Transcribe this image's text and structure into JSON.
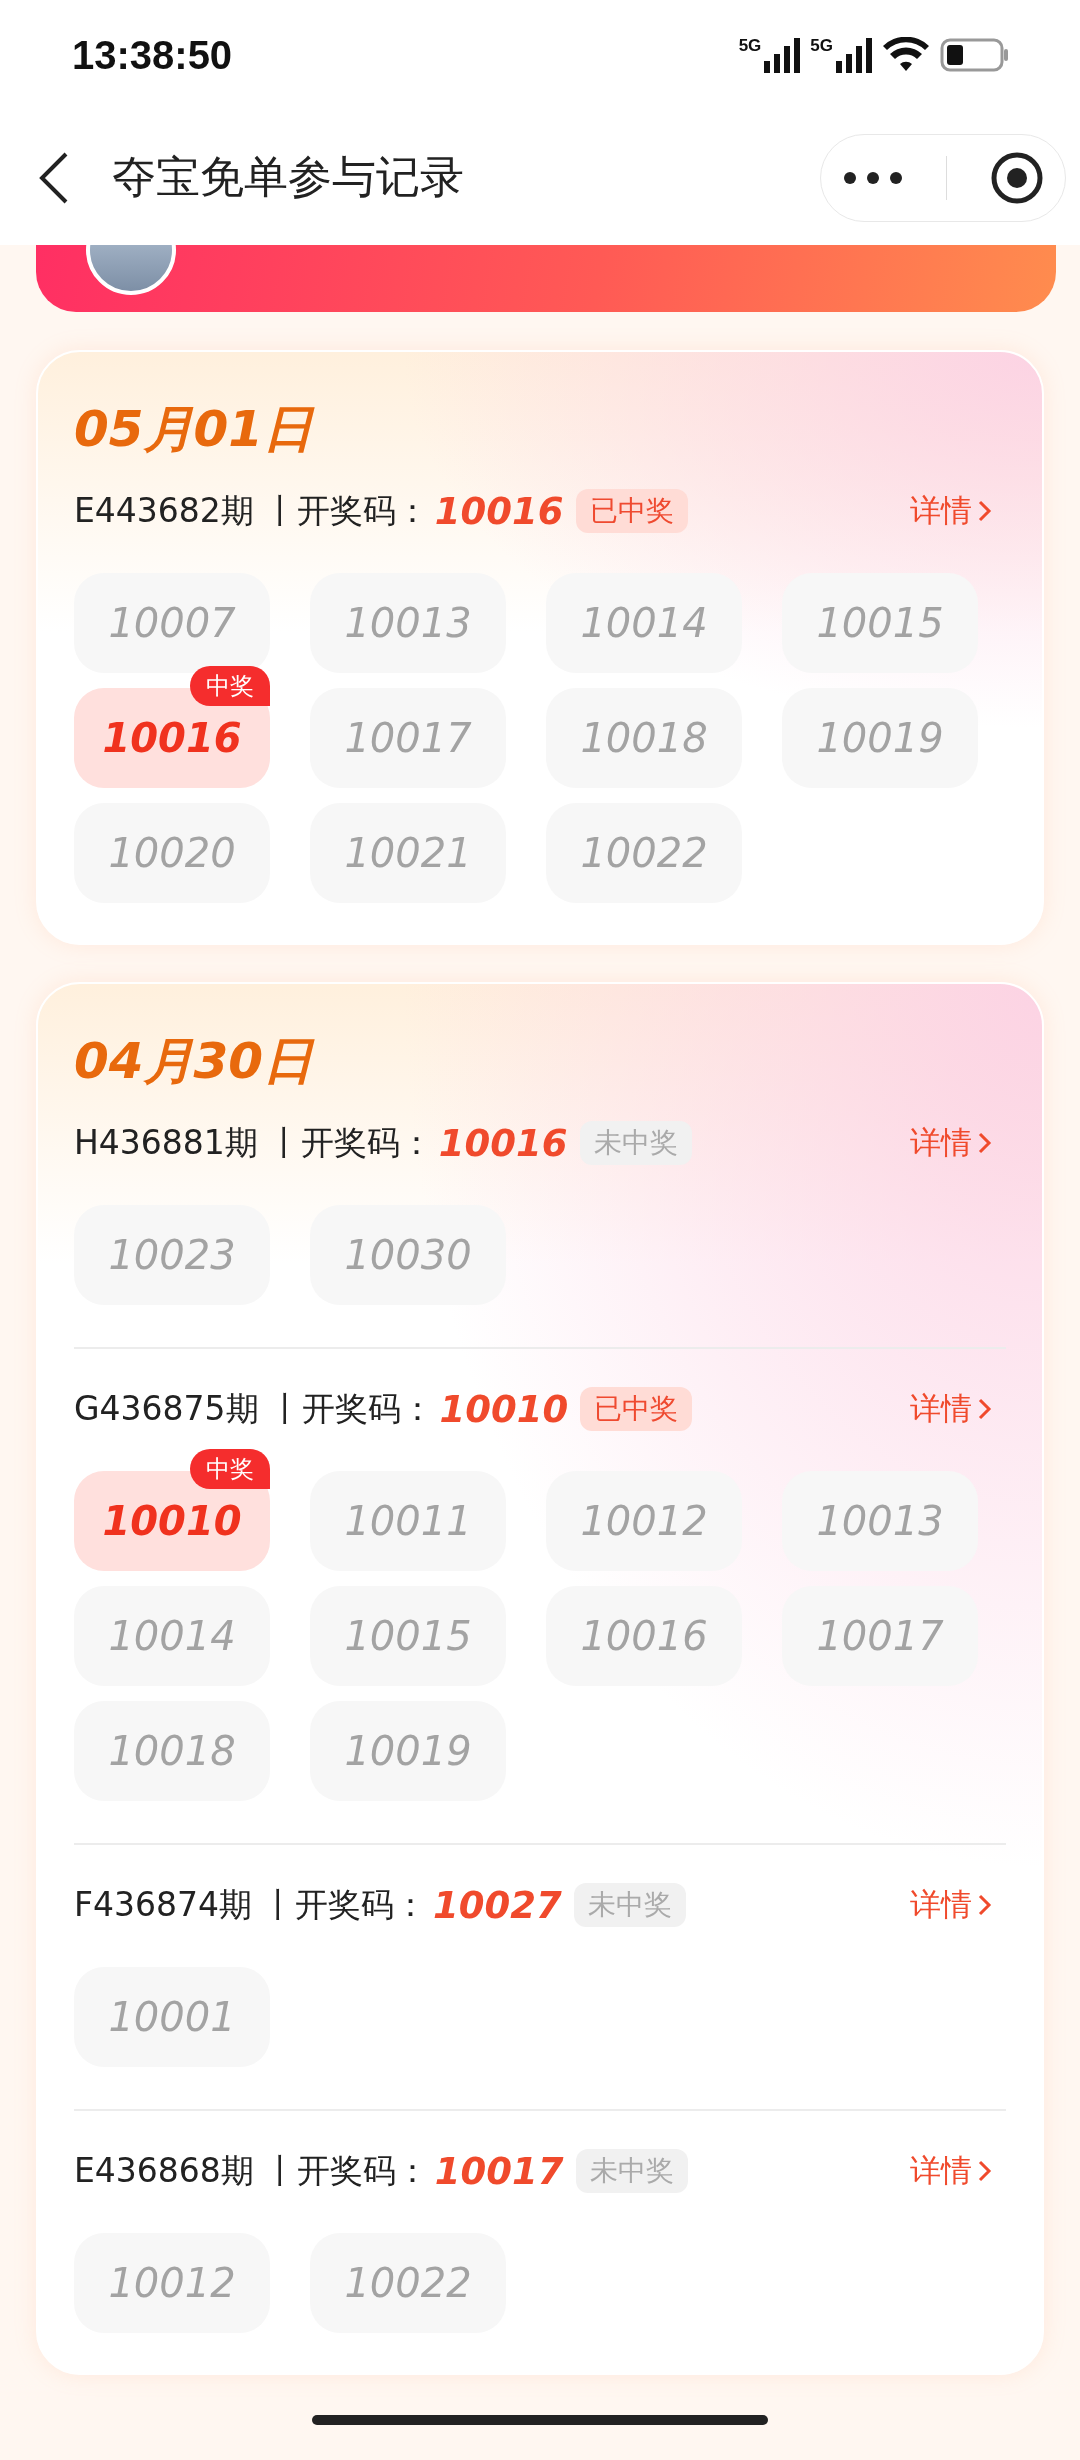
{
  "status_bar": {
    "time": "13:38:50",
    "networks": [
      "5G",
      "5G"
    ]
  },
  "nav": {
    "title": "夺宝免单参与记录"
  },
  "days": [
    {
      "date": "05月01日",
      "periods": [
        {
          "period": "E443682期",
          "code_label": "丨开奖码：",
          "code": "10016",
          "status": "已中奖",
          "won": true,
          "detail": "详情",
          "tickets": [
            {
              "number": "10007",
              "won": false
            },
            {
              "number": "10013",
              "won": false
            },
            {
              "number": "10014",
              "won": false
            },
            {
              "number": "10015",
              "won": false
            },
            {
              "number": "10016",
              "won": true,
              "badge": "中奖"
            },
            {
              "number": "10017",
              "won": false
            },
            {
              "number": "10018",
              "won": false
            },
            {
              "number": "10019",
              "won": false
            },
            {
              "number": "10020",
              "won": false
            },
            {
              "number": "10021",
              "won": false
            },
            {
              "number": "10022",
              "won": false
            }
          ]
        }
      ]
    },
    {
      "date": "04月30日",
      "periods": [
        {
          "period": "H436881期",
          "code_label": "丨开奖码：",
          "code": "10016",
          "status": "未中奖",
          "won": false,
          "detail": "详情",
          "tickets": [
            {
              "number": "10023",
              "won": false
            },
            {
              "number": "10030",
              "won": false
            }
          ]
        },
        {
          "period": "G436875期",
          "code_label": "丨开奖码：",
          "code": "10010",
          "status": "已中奖",
          "won": true,
          "detail": "详情",
          "tickets": [
            {
              "number": "10010",
              "won": true,
              "badge": "中奖"
            },
            {
              "number": "10011",
              "won": false
            },
            {
              "number": "10012",
              "won": false
            },
            {
              "number": "10013",
              "won": false
            },
            {
              "number": "10014",
              "won": false
            },
            {
              "number": "10015",
              "won": false
            },
            {
              "number": "10016",
              "won": false
            },
            {
              "number": "10017",
              "won": false
            },
            {
              "number": "10018",
              "won": false
            },
            {
              "number": "10019",
              "won": false
            }
          ]
        },
        {
          "period": "F436874期",
          "code_label": "丨开奖码：",
          "code": "10027",
          "status": "未中奖",
          "won": false,
          "detail": "详情",
          "tickets": [
            {
              "number": "10001",
              "won": false
            }
          ]
        },
        {
          "period": "E436868期",
          "code_label": "丨开奖码：",
          "code": "10017",
          "status": "未中奖",
          "won": false,
          "detail": "详情",
          "tickets": [
            {
              "number": "10012",
              "won": false
            },
            {
              "number": "10022",
              "won": false
            }
          ]
        }
      ]
    }
  ]
}
